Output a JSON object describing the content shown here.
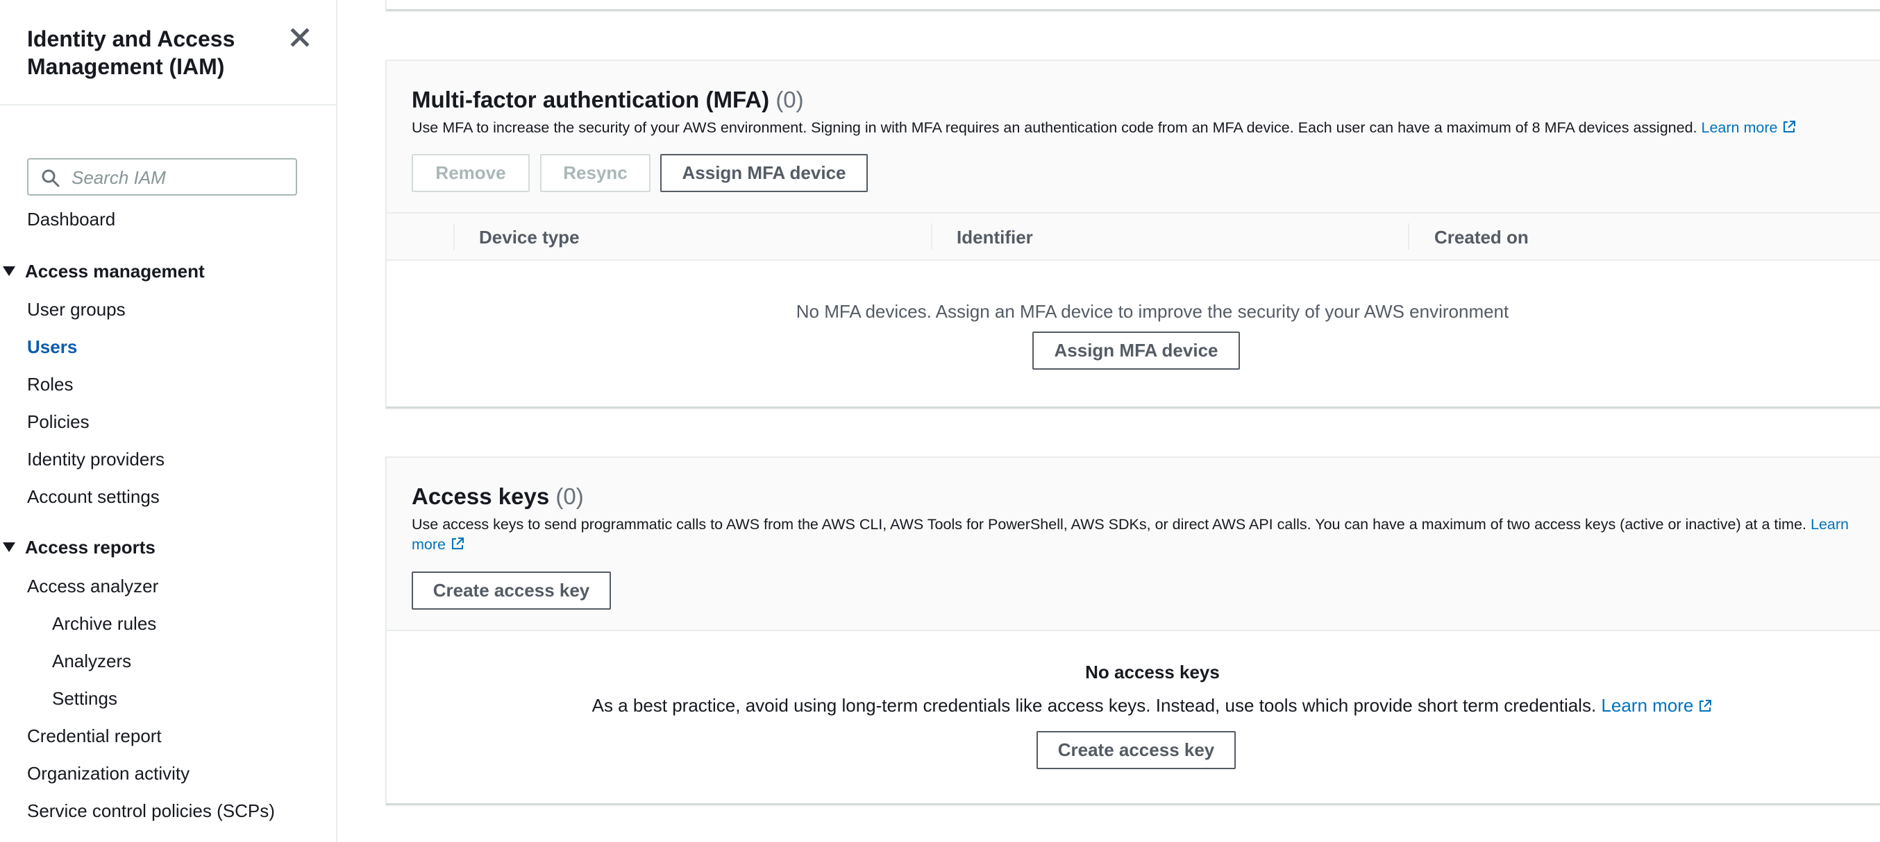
{
  "sidebar": {
    "title": "Identity and Access Management (IAM)",
    "search_placeholder": "Search IAM",
    "dashboard": "Dashboard",
    "access_management": {
      "heading": "Access management",
      "items": [
        "User groups",
        "Users",
        "Roles",
        "Policies",
        "Identity providers",
        "Account settings"
      ],
      "active": "Users"
    },
    "access_reports": {
      "heading": "Access reports",
      "access_analyzer": "Access analyzer",
      "analyzer_items": [
        "Archive rules",
        "Analyzers",
        "Settings"
      ],
      "items": [
        "Credential report",
        "Organization activity",
        "Service control policies (SCPs)"
      ]
    }
  },
  "mfa": {
    "title": "Multi-factor authentication (MFA)",
    "count": "(0)",
    "description": "Use MFA to increase the security of your AWS environment. Signing in with MFA requires an authentication code from an MFA device. Each user can have a maximum of 8 MFA devices assigned.",
    "learn_more": "Learn more",
    "buttons": {
      "remove": "Remove",
      "resync": "Resync",
      "assign": "Assign MFA device"
    },
    "columns": [
      "Device type",
      "Identifier",
      "Created on"
    ],
    "empty_text": "No MFA devices. Assign an MFA device to improve the security of your AWS environment",
    "empty_button": "Assign MFA device"
  },
  "access_keys": {
    "title": "Access keys",
    "count": "(0)",
    "description_a": "Use access keys to send programmatic calls to AWS from the AWS CLI, AWS Tools for PowerShell, AWS SDKs, or direct AWS API calls. You can have a maximum of two access keys (active or inactive) at a time.",
    "learn_more_a": "Learn",
    "learn_more_b": "more",
    "create_button": "Create access key",
    "empty_title": "No access keys",
    "empty_body": "As a best practice, avoid using long-term credentials like access keys. Instead, use tools which provide short term credentials.",
    "empty_learn_more": "Learn more",
    "empty_button": "Create access key"
  },
  "colors": {
    "link": "#0073bb",
    "active_nav": "#0a5cad",
    "text": "#16191f",
    "muted": "#545b64"
  },
  "icons": [
    "close-icon",
    "search-icon",
    "caret-down-icon",
    "external-link-icon"
  ]
}
